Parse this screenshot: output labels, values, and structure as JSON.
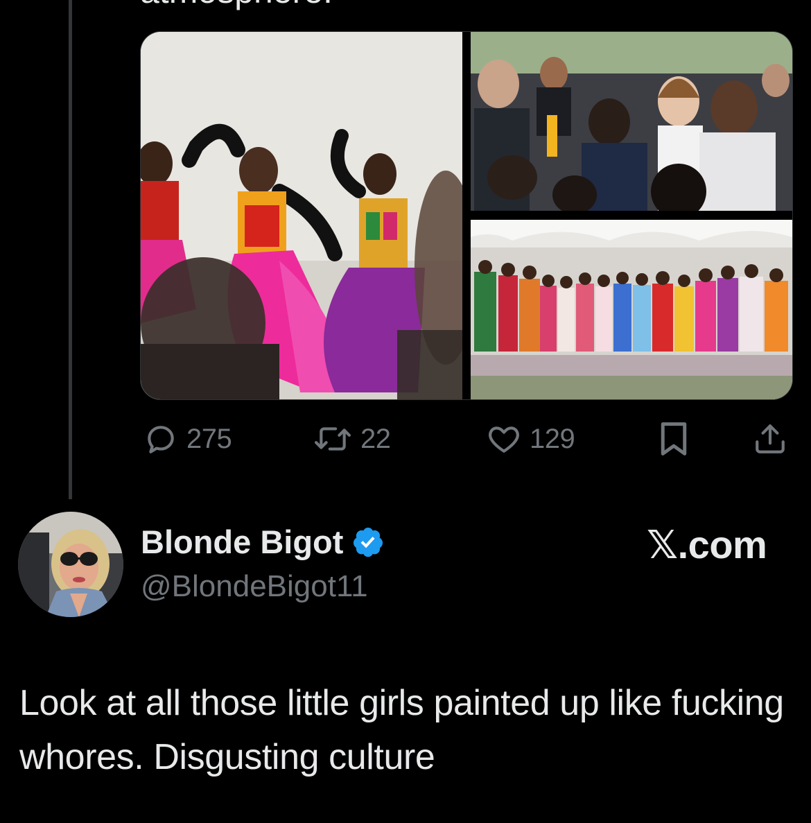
{
  "previous_tweet": {
    "cutoff_text": "atmosphere.",
    "actions": {
      "replies": "275",
      "retweets": "22",
      "likes": "129"
    }
  },
  "reply_tweet": {
    "display_name": "Blonde Bigot",
    "handle": "@BlondeBigot11",
    "verified": true,
    "watermark": "𝕏.com",
    "text": "Look at all those little girls painted up like fucking whores. Disgusting culture"
  },
  "colors": {
    "background": "#000000",
    "text_primary": "#e7e9ea",
    "text_secondary": "#71767b",
    "verified_blue": "#1d9bf0",
    "thread_line": "#333639"
  },
  "icons": {
    "reply": "speech-bubble-icon",
    "retweet": "retweet-arrows-icon",
    "like": "heart-icon",
    "bookmark": "bookmark-icon",
    "share": "share-upload-icon",
    "verified": "verified-badge-icon"
  }
}
